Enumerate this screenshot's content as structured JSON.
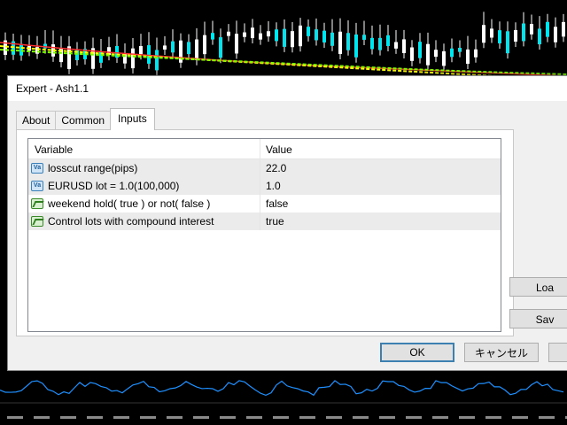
{
  "window": {
    "title": "Expert - Ash1.1"
  },
  "tabs": [
    {
      "label": "About"
    },
    {
      "label": "Common"
    },
    {
      "label": "Inputs"
    }
  ],
  "active_tab": "Inputs",
  "table": {
    "headers": {
      "variable": "Variable",
      "value": "Value"
    },
    "rows": [
      {
        "icon": "numeric-param-icon",
        "icon_text": "Va",
        "variable": "losscut range(pips)",
        "value": "22.0"
      },
      {
        "icon": "numeric-param-icon",
        "icon_text": "Va",
        "variable": "EURUSD lot = 1.0(100,000)",
        "value": "1.0"
      },
      {
        "icon": "bool-param-icon",
        "variable": "weekend hold( true ) or not( false )",
        "value": "false"
      },
      {
        "icon": "bool-param-icon",
        "variable": "Control lots with compound interest",
        "value": "true"
      }
    ]
  },
  "buttons": {
    "load": "Loa",
    "save": "Sav",
    "ok": "OK",
    "cancel": "キャンセル"
  },
  "colors": {
    "chart_bg": "#000000",
    "candle": "#00e5ee",
    "ma_yellow": "#ffff00",
    "ma_green": "#7cfc00",
    "ma_red": "#ff3030",
    "indicator_line": "#1e90ff"
  }
}
